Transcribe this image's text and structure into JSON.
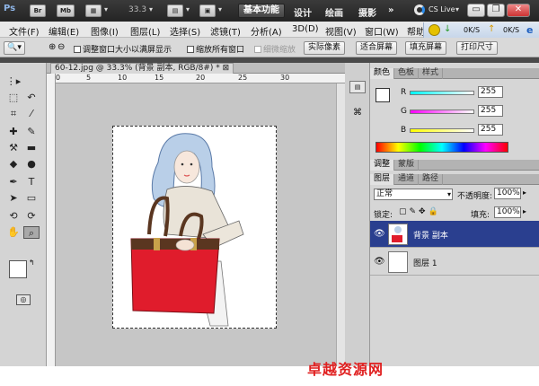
{
  "app": {
    "logo": "Ps",
    "bar_buttons": [
      "Br",
      "Mb"
    ],
    "zoom": "33.3",
    "workspace_active": "基本功能",
    "workspaces": [
      "设计",
      "绘画",
      "摄影"
    ],
    "more": "»",
    "cslive": "CS Live"
  },
  "menu": {
    "items": [
      "文件(F)",
      "编辑(E)",
      "图像(I)",
      "图层(L)",
      "选择(S)",
      "滤镜(T)",
      "分析(A)",
      "3D(D)",
      "视图(V)",
      "窗口(W)",
      "帮助"
    ]
  },
  "net": {
    "down": "0K/S",
    "up": "0K/S"
  },
  "options": {
    "checks": [
      "调整窗口大小以满屏显示",
      "缩放所有窗口",
      "细微缩放"
    ],
    "buttons": [
      "实际像素",
      "适合屏幕",
      "填充屏幕",
      "打印尺寸"
    ]
  },
  "document": {
    "tab_title": "60-12.jpg @ 33.3% (背景 副本, RGB/8#) *",
    "ruler_numbers": [
      "0",
      "5",
      "10",
      "15",
      "20",
      "25",
      "30"
    ]
  },
  "color_panel": {
    "tabs": [
      "颜色",
      "色板",
      "样式"
    ],
    "channels": [
      {
        "label": "R",
        "value": "255",
        "color": "#e03030"
      },
      {
        "label": "G",
        "value": "255",
        "color": "#ff40ff"
      },
      {
        "label": "B",
        "value": "255",
        "color": "#e8e000"
      }
    ]
  },
  "adjust_panel": {
    "tabs": [
      "调整",
      "蒙版"
    ]
  },
  "layers_panel": {
    "tabs": [
      "图层",
      "通道",
      "路径"
    ],
    "blend_mode": "正常",
    "opacity_label": "不透明度:",
    "opacity": "100%",
    "lock_label": "锁定:",
    "fill_label": "填充:",
    "fill": "100%",
    "layers": [
      {
        "name": "背景 副本",
        "selected": true
      },
      {
        "name": "图层 1",
        "selected": false
      }
    ]
  },
  "watermark": "卓越资源网"
}
